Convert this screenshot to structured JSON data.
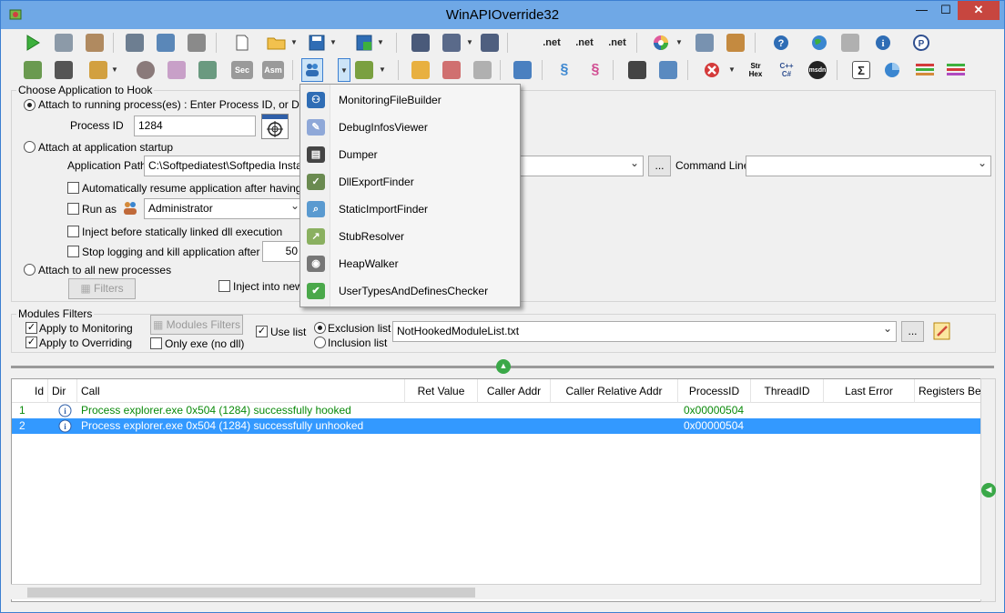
{
  "window": {
    "title": "WinAPIOverride32",
    "min_label": "—",
    "max_label": "☐",
    "close_label": "✕"
  },
  "toolbar1": {
    "net_labels": [
      ".net",
      ".net",
      ".net"
    ]
  },
  "toolbar2": {
    "sec_label": "Sec",
    "asm_label": "Asm",
    "str_label": "Str",
    "hex_label": "Hex",
    "cpp_label": "C++",
    "cs_label": "C#",
    "msdn_label": "msdn",
    "sigma_label": "Σ"
  },
  "hook": {
    "group_label": "Choose Application to Hook",
    "attach_running_label": "Attach to running process(es) : Enter Process ID, or Drag an",
    "process_id_label": "Process ID",
    "process_id_value": "1284",
    "attach_startup_label": "Attach at application startup",
    "app_path_label": "Application Path",
    "app_path_value": "C:\\Softpediatest\\Softpedia Installe",
    "browse_label": "...",
    "command_line_label": "Command Line",
    "command_line_value": "",
    "auto_resume_label": "Automatically resume application after having load",
    "run_as_label": "Run as",
    "run_as_value": "Administrator",
    "inject_static_label": "Inject before statically linked dll execution",
    "stop_logging_label": "Stop logging and kill application after :",
    "stop_logging_value": "50",
    "attach_new_label": "Attach to all new processes",
    "filters_label": "Filters",
    "inject_into_new_label": "Inject into new"
  },
  "modules": {
    "group_label": "Modules Filters",
    "apply_monitoring_label": "Apply to Monitoring",
    "apply_overriding_label": "Apply to Overriding",
    "modules_filters_button": "Modules Filters",
    "only_exe_label": "Only exe (no dll)",
    "use_list_label": "Use list",
    "exclusion_label": "Exclusion list",
    "inclusion_label": "Inclusion list",
    "list_file_value": "NotHookedModuleList.txt",
    "browse_label": "..."
  },
  "grid": {
    "columns": [
      "Id",
      "Dir",
      "Call",
      "Ret Value",
      "Caller Addr",
      "Caller Relative Addr",
      "ProcessID",
      "ThreadID",
      "Last Error",
      "Registers Befo"
    ],
    "rows": [
      {
        "id": "1",
        "call": "Process explorer.exe 0x504 (1284) successfully hooked",
        "process_id": "0x00000504"
      },
      {
        "id": "2",
        "call": "Process explorer.exe 0x504 (1284) successfully unhooked",
        "process_id": "0x00000504"
      }
    ]
  },
  "menu": {
    "items": [
      "MonitoringFileBuilder",
      "DebugInfosViewer",
      "Dumper",
      "DllExportFinder",
      "StaticImportFinder",
      "StubResolver",
      "HeapWalker",
      "UserTypesAndDefinesChecker"
    ]
  },
  "colors": {
    "titlebar": "#6fa8e6",
    "selection": "#3399ff",
    "success_text": "#0a8a0a",
    "close_button": "#c7463f"
  }
}
